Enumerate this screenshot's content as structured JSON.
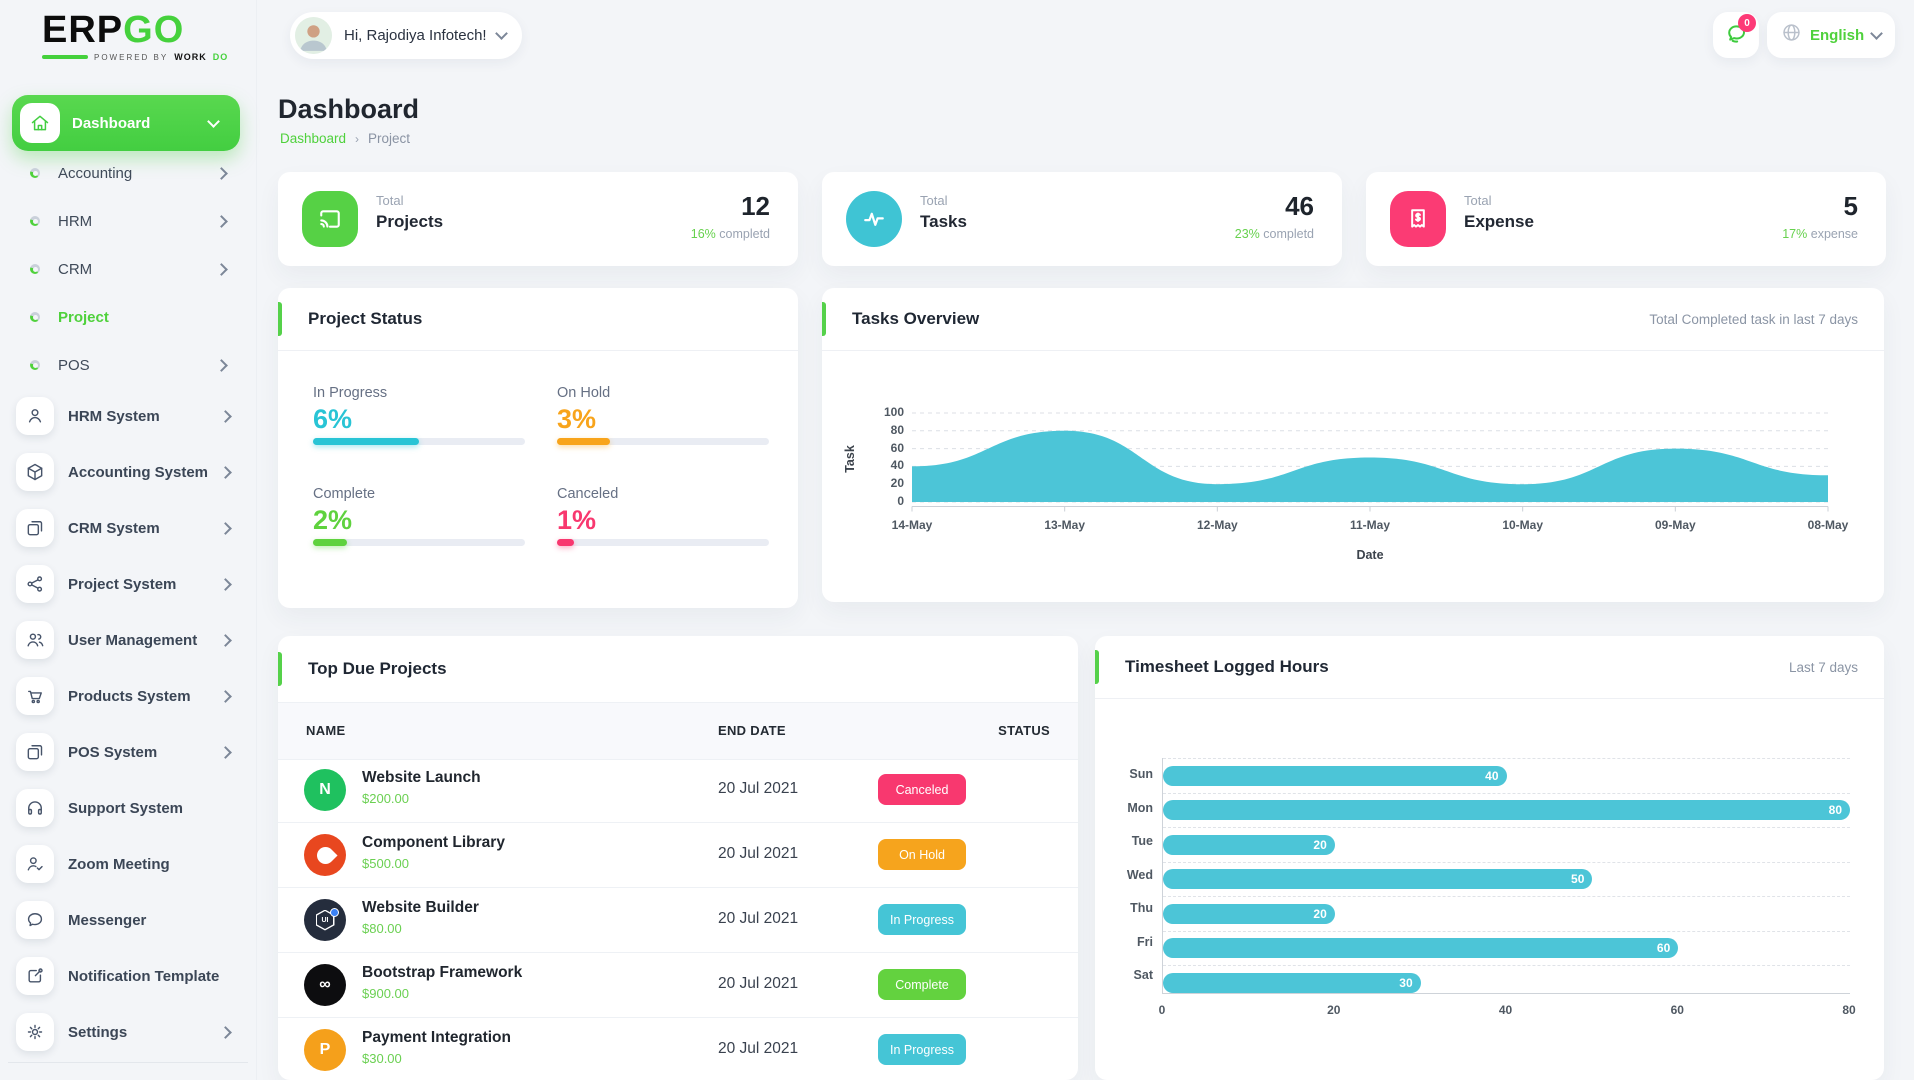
{
  "brand": {
    "erp": "ERP",
    "go": "GO",
    "powered_by": "POWERED BY",
    "workdo_dark": "WORK",
    "workdo_green": "DO"
  },
  "header": {
    "greeting": "Hi, Rajodiya Infotech!",
    "notification_badge": "0",
    "language": "English"
  },
  "page": {
    "title": "Dashboard",
    "breadcrumb_root": "Dashboard",
    "breadcrumb_separator": "›",
    "breadcrumb_current": "Project"
  },
  "sidebar": {
    "dashboard": {
      "label": "Dashboard",
      "icon": "home-icon"
    },
    "children": [
      {
        "label": "Accounting",
        "chevron": true,
        "active": false
      },
      {
        "label": "HRM",
        "chevron": true,
        "active": false
      },
      {
        "label": "CRM",
        "chevron": true,
        "active": false
      },
      {
        "label": "Project",
        "chevron": false,
        "active": true
      },
      {
        "label": "POS",
        "chevron": true,
        "active": false
      }
    ],
    "modules": [
      {
        "label": "HRM System",
        "icon": "user-icon",
        "chevron": true
      },
      {
        "label": "Accounting System",
        "icon": "cube-icon",
        "chevron": true
      },
      {
        "label": "CRM System",
        "icon": "windows-icon",
        "chevron": true
      },
      {
        "label": "Project System",
        "icon": "share-nodes-icon",
        "chevron": true
      },
      {
        "label": "User Management",
        "icon": "users-icon",
        "chevron": true
      },
      {
        "label": "Products System",
        "icon": "cart-icon",
        "chevron": true
      },
      {
        "label": "POS System",
        "icon": "windows-icon",
        "chevron": true
      },
      {
        "label": "Support System",
        "icon": "headphones-icon",
        "chevron": false
      },
      {
        "label": "Zoom Meeting",
        "icon": "user-check-icon",
        "chevron": false
      },
      {
        "label": "Messenger",
        "icon": "chat-dots-icon",
        "chevron": false
      },
      {
        "label": "Notification Template",
        "icon": "template-icon",
        "chevron": false
      },
      {
        "label": "Settings",
        "icon": "gear-icon",
        "chevron": true
      }
    ]
  },
  "stat_cards": [
    {
      "prefix": "Total",
      "label": "Projects",
      "value": "12",
      "percent": "16%",
      "suffix": " completd",
      "icon": "cast-icon",
      "icon_bg": "#56d145",
      "icon_shape": "squircle"
    },
    {
      "prefix": "Total",
      "label": "Tasks",
      "value": "46",
      "percent": "23%",
      "suffix": " completd",
      "icon": "activity-icon",
      "icon_bg": "#3fc4d4",
      "icon_shape": "circle"
    },
    {
      "prefix": "Total",
      "label": "Expense",
      "value": "5",
      "percent": "17%",
      "suffix": " expense",
      "icon": "receipt-icon",
      "icon_bg": "#fb3b74",
      "icon_shape": "squircle"
    }
  ],
  "project_status": {
    "title": "Project Status",
    "items": [
      {
        "label": "In Progress",
        "percent": "6%",
        "color": "#29c4d5",
        "fill_pct": 50
      },
      {
        "label": "On Hold",
        "percent": "3%",
        "color": "#f8a41b",
        "fill_pct": 25
      },
      {
        "label": "Complete",
        "percent": "2%",
        "color": "#5fd23e",
        "fill_pct": 16
      },
      {
        "label": "Canceled",
        "percent": "1%",
        "color": "#f8386f",
        "fill_pct": 8
      }
    ]
  },
  "tasks_overview": {
    "title": "Tasks Overview",
    "right_label": "Total Completed task in last 7 days"
  },
  "top_due_projects": {
    "title": "Top Due Projects",
    "columns": [
      "NAME",
      "END DATE",
      "STATUS"
    ],
    "rows": [
      {
        "name": "Website Launch",
        "price": "$200.00",
        "end_date": "20 Jul 2021",
        "status": "Canceled",
        "status_color": "#f8386f",
        "avatar": {
          "bg": "#1fc15f",
          "type": "text",
          "text": "N"
        }
      },
      {
        "name": "Component Library",
        "price": "$500.00",
        "end_date": "20 Jul 2021",
        "status": "On Hold",
        "status_color": "#f6a41d",
        "avatar": {
          "bg": "#e8471f",
          "type": "drop",
          "text": ""
        }
      },
      {
        "name": "Website Builder",
        "price": "$80.00",
        "end_date": "20 Jul 2021",
        "status": "In Progress",
        "status_color": "#45c5d6",
        "avatar": {
          "bg": "#252d3d",
          "type": "ui",
          "text": "UI"
        }
      },
      {
        "name": "Bootstrap Framework",
        "price": "$900.00",
        "end_date": "20 Jul 2021",
        "status": "Complete",
        "status_color": "#63d23f",
        "avatar": {
          "bg": "#0d0d0f",
          "type": "text",
          "text": "∞"
        }
      },
      {
        "name": "Payment Integration",
        "price": "$30.00",
        "end_date": "20 Jul 2021",
        "status": "In Progress",
        "status_color": "#45c5d6",
        "avatar": {
          "bg": "#f5a01b",
          "type": "text",
          "text": "P"
        }
      }
    ]
  },
  "timesheet": {
    "title": "Timesheet Logged Hours",
    "right_label": "Last 7 days"
  },
  "chart_data": [
    {
      "id": "tasks_overview",
      "type": "area",
      "title": "Tasks Overview",
      "subtitle": "Total Completed task in last 7 days",
      "x": [
        "14-May",
        "13-May",
        "12-May",
        "11-May",
        "10-May",
        "09-May",
        "08-May"
      ],
      "values": [
        40,
        80,
        20,
        50,
        20,
        60,
        30
      ],
      "xlabel": "Date",
      "ylabel": "Task",
      "ylim": [
        0,
        100
      ],
      "yticks": [
        0,
        20,
        40,
        60,
        80,
        100
      ],
      "grid": "horizontal-dashed",
      "legend": "none",
      "fill_color": "#4cc5d7"
    },
    {
      "id": "timesheet_logged_hours",
      "type": "bar",
      "orientation": "horizontal",
      "title": "Timesheet Logged Hours",
      "subtitle": "Last 7 days",
      "categories": [
        "Sun",
        "Mon",
        "Tue",
        "Wed",
        "Thu",
        "Fri",
        "Sat"
      ],
      "values": [
        40,
        80,
        20,
        50,
        20,
        60,
        30
      ],
      "xlim": [
        0,
        80
      ],
      "xticks": [
        0,
        20,
        40,
        60,
        80
      ],
      "grid": "band-dashed",
      "bar_color": "#4cc5d7",
      "value_labels": true
    }
  ]
}
